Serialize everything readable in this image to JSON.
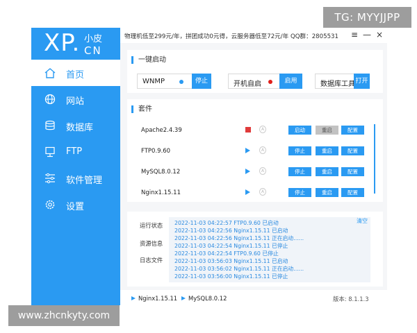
{
  "watermarks": {
    "top_right": "TG: MYYJJPP",
    "bottom_left": "www.zhcnkyty.com"
  },
  "logo": {
    "main": "XP.",
    "top": "小皮",
    "bottom": "CN"
  },
  "topbar": {
    "promo": "物理机低至299元/年，拼团成功0元得，云服务器低至72元/年  QQ群：2805531",
    "menu_icon": "≡",
    "minimize_icon": "—",
    "close_icon": "×"
  },
  "sidebar": {
    "items": [
      {
        "label": "首页",
        "icon": "home-icon"
      },
      {
        "label": "网站",
        "icon": "globe-icon"
      },
      {
        "label": "数据库",
        "icon": "database-icon"
      },
      {
        "label": "FTP",
        "icon": "ftp-icon"
      },
      {
        "label": "软件管理",
        "icon": "sliders-icon"
      },
      {
        "label": "设置",
        "icon": "gear-icon"
      }
    ]
  },
  "quick_start": {
    "title": "一键启动",
    "items": [
      {
        "label": "WNMP",
        "dot_color": "#2a9af2",
        "button": "停止"
      },
      {
        "label": "开机自启",
        "dot_color": "#e0201b",
        "button": "启用"
      },
      {
        "label": "数据库工具",
        "button": "打开"
      }
    ]
  },
  "suite": {
    "title": "套件",
    "rows": [
      {
        "name": "Apache2.4.39",
        "state": "stopped",
        "btn1": "启动",
        "btn2": "重启",
        "btn3": "配置"
      },
      {
        "name": "FTP0.9.60",
        "state": "running",
        "btn1": "停止",
        "btn2": "重启",
        "btn3": "配置"
      },
      {
        "name": "MySQL8.0.12",
        "state": "running",
        "btn1": "停止",
        "btn2": "重启",
        "btn3": "配置"
      },
      {
        "name": "Nginx1.15.11",
        "state": "running",
        "btn1": "停止",
        "btn2": "重启",
        "btn3": "配置"
      }
    ]
  },
  "log": {
    "tabs": [
      "运行状态",
      "资源信息",
      "日志文件"
    ],
    "clear": "清空",
    "lines": [
      "2022-11-03 04:22:57 FTP0.9.60 已启动",
      "2022-11-03 04:22:56 Nginx1.15.11 已启动",
      "2022-11-03 04:22:56 Nginx1.15.11 正在启动......",
      "2022-11-03 04:22:54 Nginx1.15.11 已停止",
      "2022-11-03 04:22:54 FTP0.9.60 已停止",
      "2022-11-03 03:56:03 Nginx1.15.11 已启动",
      "2022-11-03 03:56:02 Nginx1.15.11 正在启动......",
      "2022-11-03 03:56:00 Nginx1.15.11 已停止"
    ]
  },
  "statusbar": {
    "items": [
      "Nginx1.15.11",
      "MySQL8.0.12"
    ],
    "version": "版本: 8.1.1.3"
  }
}
